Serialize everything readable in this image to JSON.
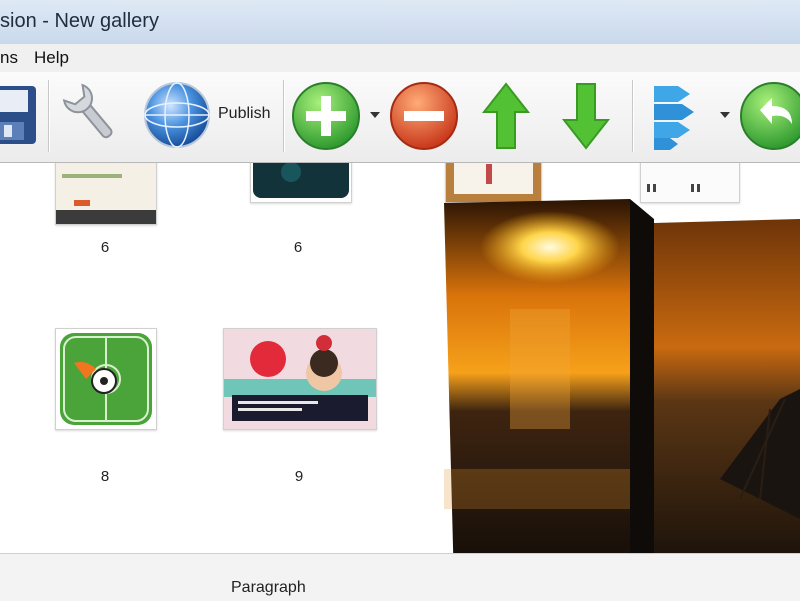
{
  "window": {
    "title": "sion - New gallery"
  },
  "menu": {
    "items": [
      "ns",
      "Help"
    ]
  },
  "toolbar": {
    "save_icon": "save-icon",
    "settings_icon": "wrench-icon",
    "publish_label": "Publish",
    "add_icon": "plus-icon",
    "remove_icon": "minus-icon",
    "up_icon": "arrow-up-icon",
    "down_icon": "arrow-down-icon",
    "rotate_icon": "undo-icon"
  },
  "gallery": {
    "row1_labels": [
      "6",
      "6"
    ],
    "row2_labels": [
      "8",
      "9"
    ]
  },
  "status": {
    "text": "Paragraph"
  },
  "colors": {
    "add_green": "#3aa53a",
    "remove_red": "#d9461e",
    "arrow_green": "#52c234",
    "publish_blue": "#3b7fd1"
  }
}
